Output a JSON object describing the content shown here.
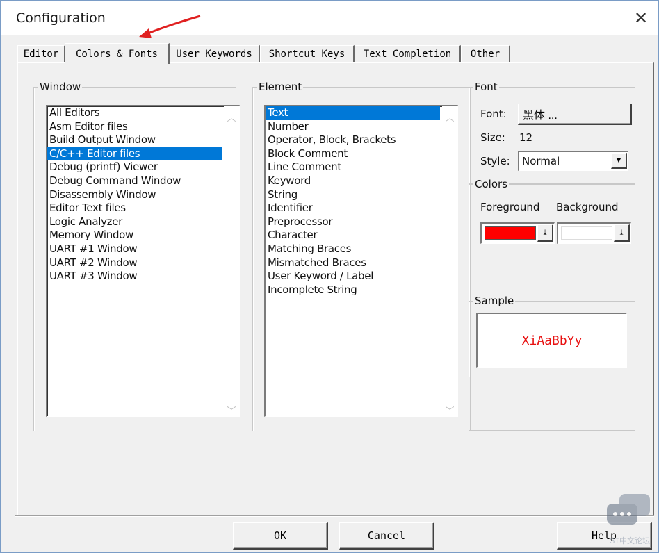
{
  "window": {
    "title": "Configuration"
  },
  "tabs": [
    {
      "label": "Editor"
    },
    {
      "label": "Colors & Fonts"
    },
    {
      "label": "User Keywords"
    },
    {
      "label": "Shortcut Keys"
    },
    {
      "label": "Text Completion"
    },
    {
      "label": "Other"
    }
  ],
  "active_tab": "Colors & Fonts",
  "window_group": {
    "legend": "Window",
    "items": [
      "All Editors",
      "Asm Editor files",
      "Build Output Window",
      "C/C++ Editor files",
      "Debug (printf) Viewer",
      "Debug Command Window",
      "Disassembly Window",
      "Editor Text files",
      "Logic Analyzer",
      "Memory Window",
      "UART #1 Window",
      "UART #2 Window",
      "UART #3 Window"
    ],
    "selected": "C/C++ Editor files"
  },
  "element_group": {
    "legend": "Element",
    "items": [
      "Text",
      "Number",
      "Operator, Block, Brackets",
      "Block Comment",
      "Line Comment",
      "Keyword",
      "String",
      "Identifier",
      "Preprocessor",
      "Character",
      "Matching Braces",
      "Mismatched Braces",
      "User Keyword / Label",
      "Incomplete String"
    ],
    "selected": "Text"
  },
  "font_group": {
    "legend": "Font",
    "font_label": "Font:",
    "font_value": "黑体 ...",
    "size_label": "Size:",
    "size_value": "12",
    "style_label": "Style:",
    "style_value": "Normal"
  },
  "colors_group": {
    "legend": "Colors",
    "foreground_label": "Foreground",
    "background_label": "Background",
    "foreground_color": "#ff0000",
    "background_color": "#ffffff"
  },
  "sample_group": {
    "legend": "Sample",
    "text": "XiAaBbYy",
    "color": "#e81010"
  },
  "buttons": {
    "ok": "OK",
    "cancel": "Cancel",
    "help": "Help"
  },
  "watermark": {
    "text": "ST中文论坛"
  },
  "annotation": {
    "arrow_color": "#e02020"
  }
}
